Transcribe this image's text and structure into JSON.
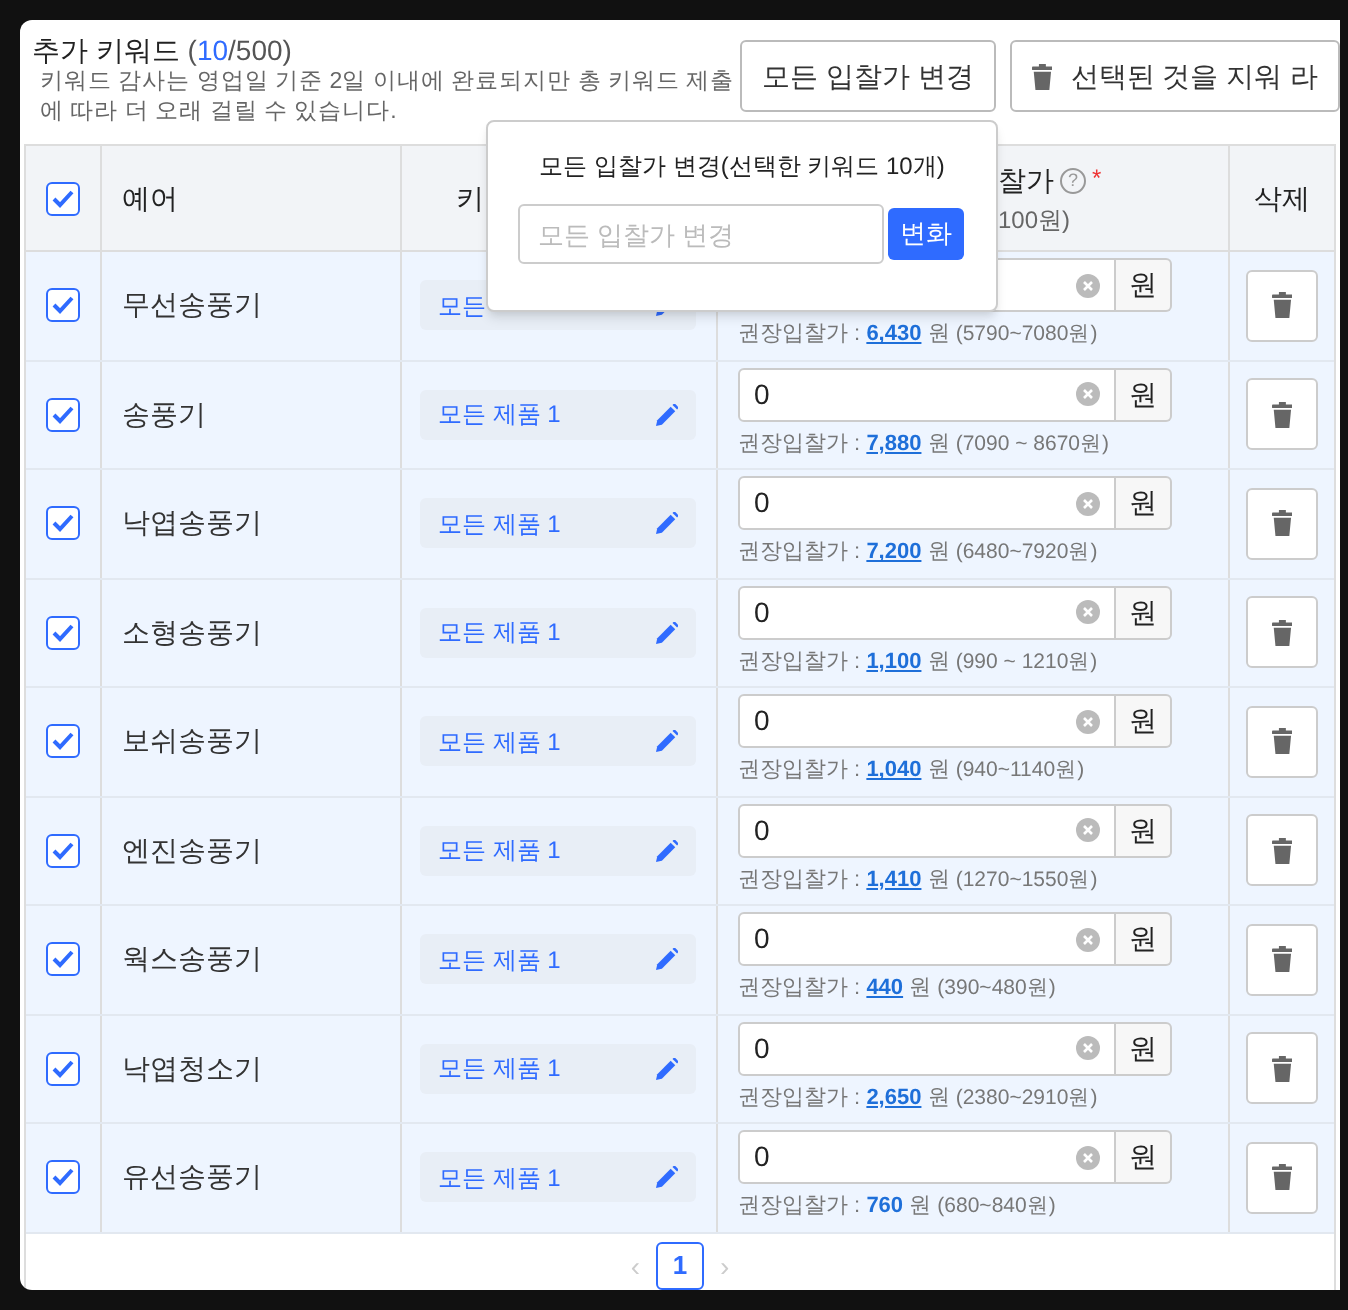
{
  "header": {
    "title": "추가 키워드",
    "count_open": "(",
    "count": "10",
    "count_rest": "/500)",
    "note": "키워드 감사는 영업일 기준 2일 이내에 완료되지만 총 키워드 제출에 따라 더 오래 걸릴 수 있습니다.",
    "buttons": [
      {
        "kind": "plain",
        "label": "모든 입찰가 변경"
      },
      {
        "kind": "trash",
        "label": "선택된 것을 지워 라"
      }
    ]
  },
  "popover": {
    "title": "모든 입찰가 변경(선택한 키워드 10개)",
    "placeholder": "모든 입찰가 변경",
    "button": "변화"
  },
  "table": {
    "select_all": {
      "checked": true
    },
    "columns": [
      {
        "label": "예어"
      },
      {
        "label": "키"
      },
      {
        "label": "찰가",
        "sub": "100원)",
        "required": "*",
        "help": "?"
      },
      {
        "label": "삭제"
      }
    ],
    "rows": [
      {
        "checked": true,
        "keyword": "무선송풍기",
        "product": "모든",
        "value": "",
        "unit": "원",
        "rec_label": "권장입찰가 :",
        "rec_price": "6,430",
        "rec_unit": "원",
        "rec_range": "(5790~7080원)",
        "underlined": true
      },
      {
        "checked": true,
        "keyword": "송풍기",
        "product": "모든 제품 1",
        "value": "0",
        "unit": "원",
        "rec_label": "권장입찰가 :",
        "rec_price": "7,880",
        "rec_unit": "원",
        "rec_range": "(7090 ~ 8670원)",
        "underlined": true
      },
      {
        "checked": true,
        "keyword": "낙엽송풍기",
        "product": "모든 제품 1",
        "value": "0",
        "unit": "원",
        "rec_label": "권장입찰가 :",
        "rec_price": "7,200",
        "rec_unit": "원",
        "rec_range": "(6480~7920원)",
        "underlined": true
      },
      {
        "checked": true,
        "keyword": "소형송풍기",
        "product": "모든 제품 1",
        "value": "0",
        "unit": "원",
        "rec_label": "권장입찰가 :",
        "rec_price": "1,100",
        "rec_unit": "원",
        "rec_range": "(990 ~ 1210원)",
        "underlined": true
      },
      {
        "checked": true,
        "keyword": "보쉬송풍기",
        "product": "모든 제품 1",
        "value": "0",
        "unit": "원",
        "rec_label": "권장입찰가 :",
        "rec_price": "1,040",
        "rec_unit": "원",
        "rec_range": "(940~1140원)",
        "underlined": true
      },
      {
        "checked": true,
        "keyword": "엔진송풍기",
        "product": "모든 제품 1",
        "value": "0",
        "unit": "원",
        "rec_label": "권장입찰가 :",
        "rec_price": "1,410",
        "rec_unit": "원",
        "rec_range": "(1270~1550원)",
        "underlined": true
      },
      {
        "checked": true,
        "keyword": "웍스송풍기",
        "product": "모든 제품 1",
        "value": "0",
        "unit": "원",
        "rec_label": "권장입찰가 :",
        "rec_price": "440",
        "rec_unit": "원",
        "rec_range": "(390~480원)",
        "underlined": true
      },
      {
        "checked": true,
        "keyword": "낙엽청소기",
        "product": "모든 제품 1",
        "value": "0",
        "unit": "원",
        "rec_label": "권장입찰가 :",
        "rec_price": "2,650",
        "rec_unit": "원",
        "rec_range": "(2380~2910원)",
        "underlined": true
      },
      {
        "checked": true,
        "keyword": "유선송풍기",
        "product": "모든 제품 1",
        "value": "0",
        "unit": "원",
        "rec_label": "권장입찰가 :",
        "rec_price": "760",
        "rec_unit": "원",
        "rec_range": "(680~840원)",
        "underlined": false
      }
    ]
  },
  "pagination": {
    "prev": "‹",
    "next": "›",
    "pages": [
      {
        "label": "1",
        "selected": true
      }
    ]
  }
}
